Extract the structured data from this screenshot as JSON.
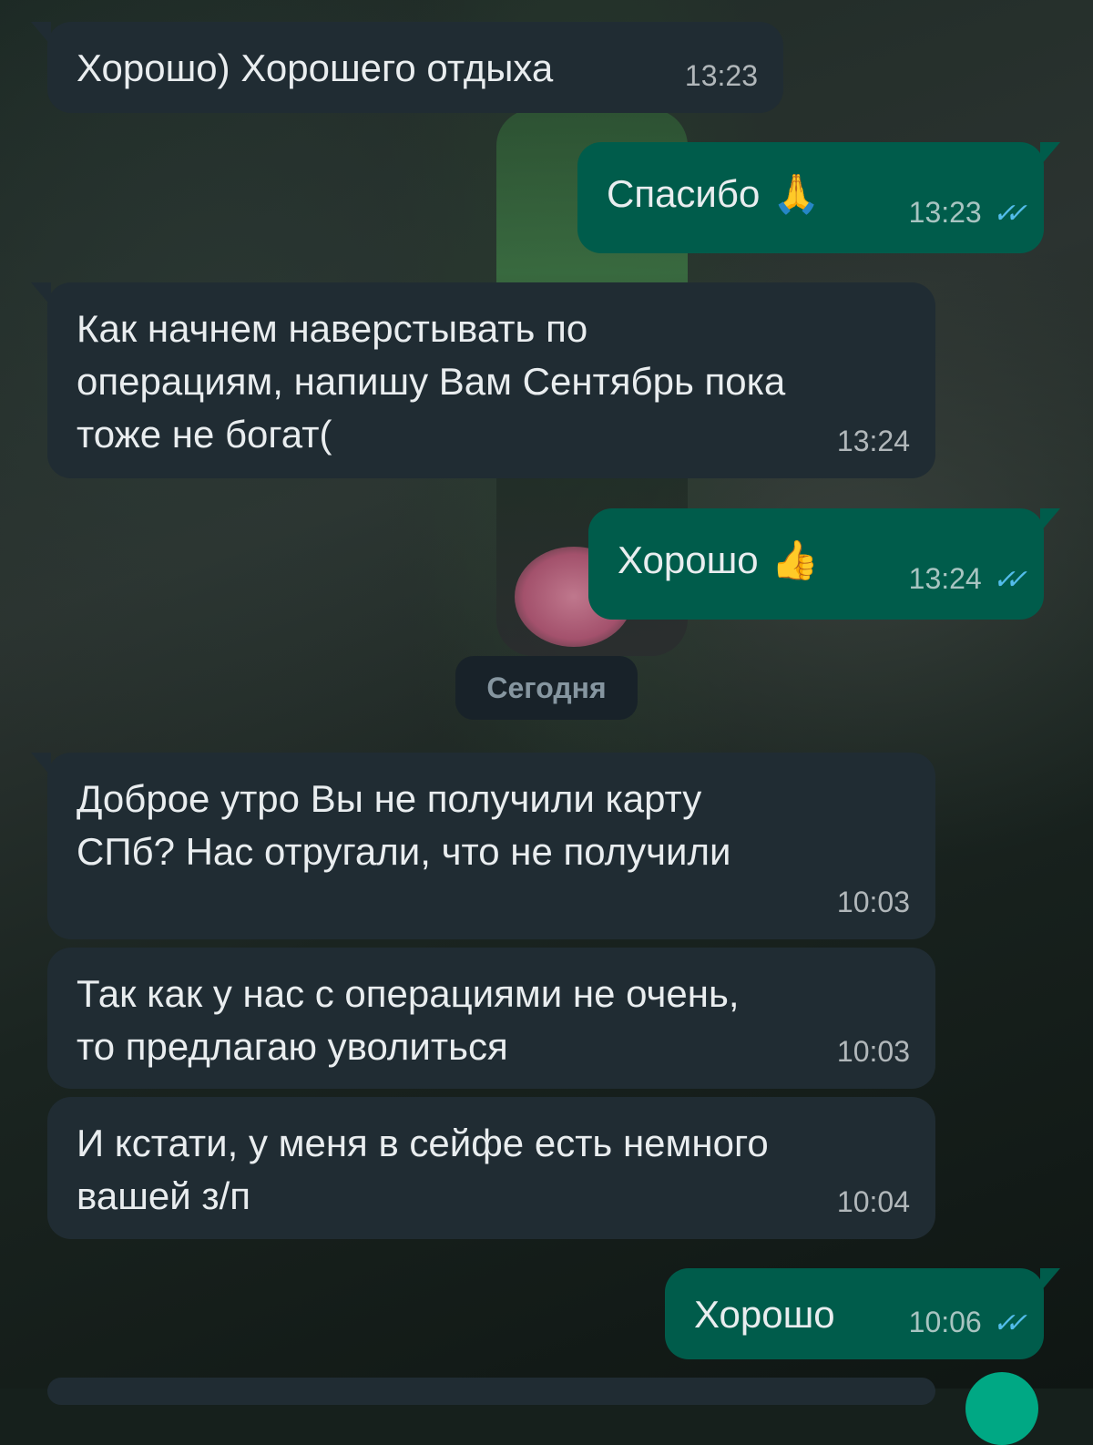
{
  "conversation": {
    "date_separator": "Сегодня",
    "messages": [
      {
        "direction": "in",
        "text": "Хорошо) Хорошего отдыха",
        "time": "13:23"
      },
      {
        "direction": "out",
        "text": "Спасибо",
        "emoji": "🙏",
        "time": "13:23",
        "read": true
      },
      {
        "direction": "in",
        "text": "Как начнем наверстывать по\nоперациям, напишу Вам Сентябрь пока\nтоже не богат(",
        "time": "13:24"
      },
      {
        "direction": "out",
        "text": "Хорошо",
        "emoji": "👍",
        "time": "13:24",
        "read": true
      },
      {
        "direction": "in",
        "text": "Доброе утро Вы не получили карту\nСПб? Нас отругали, что не получили",
        "time": "10:03"
      },
      {
        "direction": "in",
        "text": "Так как у нас с операциями не очень,\nто предлагаю уволиться",
        "time": "10:03"
      },
      {
        "direction": "in",
        "text": "И кстати, у меня в сейфе есть немного\nвашей з/п",
        "time": "10:04"
      },
      {
        "direction": "out",
        "text": "Хорошо",
        "time": "10:06",
        "read": true
      }
    ]
  },
  "icons": {
    "read_receipt": "double-check-icon",
    "read_color": "#53bdeb"
  },
  "colors": {
    "incoming_bubble": "#202c33",
    "outgoing_bubble": "#005c4b",
    "text": "#e9edef"
  }
}
